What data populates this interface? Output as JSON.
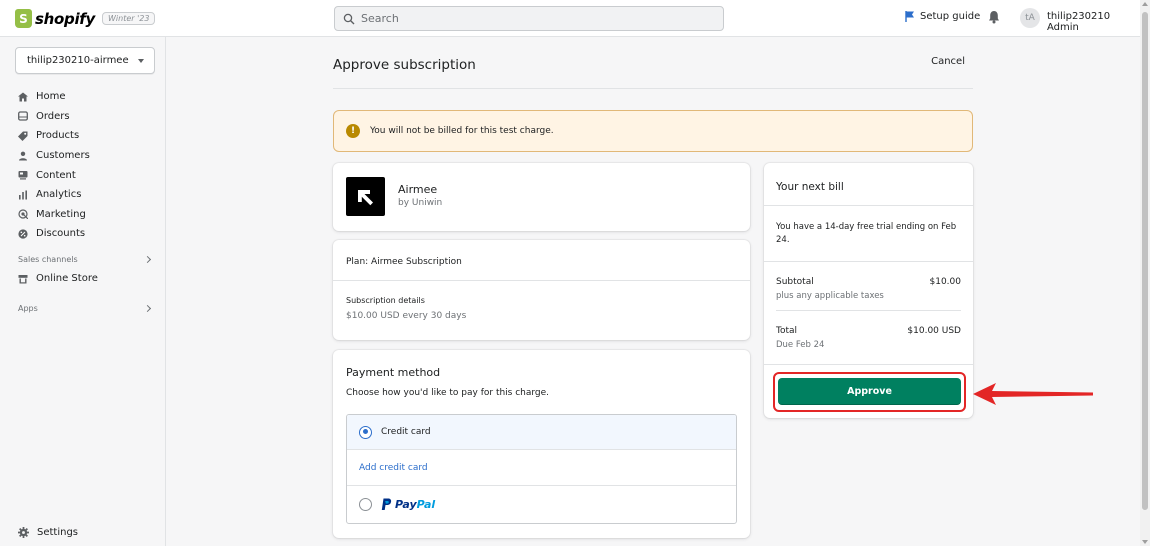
{
  "topbar": {
    "logo_text": "shopify",
    "version_badge": "Winter '23",
    "search_placeholder": "Search",
    "setup_guide": "Setup guide",
    "avatar_initials": "tA",
    "username": "thilip230210 Admin"
  },
  "sidebar": {
    "store_name": "thilip230210-airmee",
    "items": [
      {
        "label": "Home",
        "icon": "home-icon"
      },
      {
        "label": "Orders",
        "icon": "orders-icon"
      },
      {
        "label": "Products",
        "icon": "tag-icon"
      },
      {
        "label": "Customers",
        "icon": "person-icon"
      },
      {
        "label": "Content",
        "icon": "content-icon"
      },
      {
        "label": "Analytics",
        "icon": "bar-chart-icon"
      },
      {
        "label": "Marketing",
        "icon": "target-icon"
      },
      {
        "label": "Discounts",
        "icon": "discount-icon"
      }
    ],
    "sales_channels_label": "Sales channels",
    "online_store": "Online Store",
    "apps_label": "Apps",
    "settings": "Settings"
  },
  "page": {
    "title": "Approve subscription",
    "cancel": "Cancel",
    "banner": "You will not be billed for this test charge.",
    "banner_icon": "!"
  },
  "app": {
    "name": "Airmee",
    "vendor": "by Uniwin"
  },
  "plan": {
    "name": "Plan: Airmee Subscription",
    "details_label": "Subscription details",
    "details_value": "$10.00 USD every 30 days"
  },
  "payment": {
    "title": "Payment method",
    "subtitle": "Choose how you'd like to pay for this charge.",
    "credit_card": "Credit card",
    "add_card": "Add credit card",
    "paypal_pay": "Pay",
    "paypal_pal": "Pal"
  },
  "bill": {
    "title": "Your next bill",
    "trial": "You have a 14-day free trial ending on Feb 24.",
    "subtotal_label": "Subtotal",
    "subtotal_sub": "plus any applicable taxes",
    "subtotal_value": "$10.00",
    "total_label": "Total",
    "total_sub": "Due Feb 24",
    "total_value": "$10.00 USD",
    "approve": "Approve"
  },
  "colors": {
    "approve_green": "#008060",
    "highlight_red": "#e32626",
    "banner_bg": "#fff4e4",
    "link_blue": "#2c6ecb"
  }
}
